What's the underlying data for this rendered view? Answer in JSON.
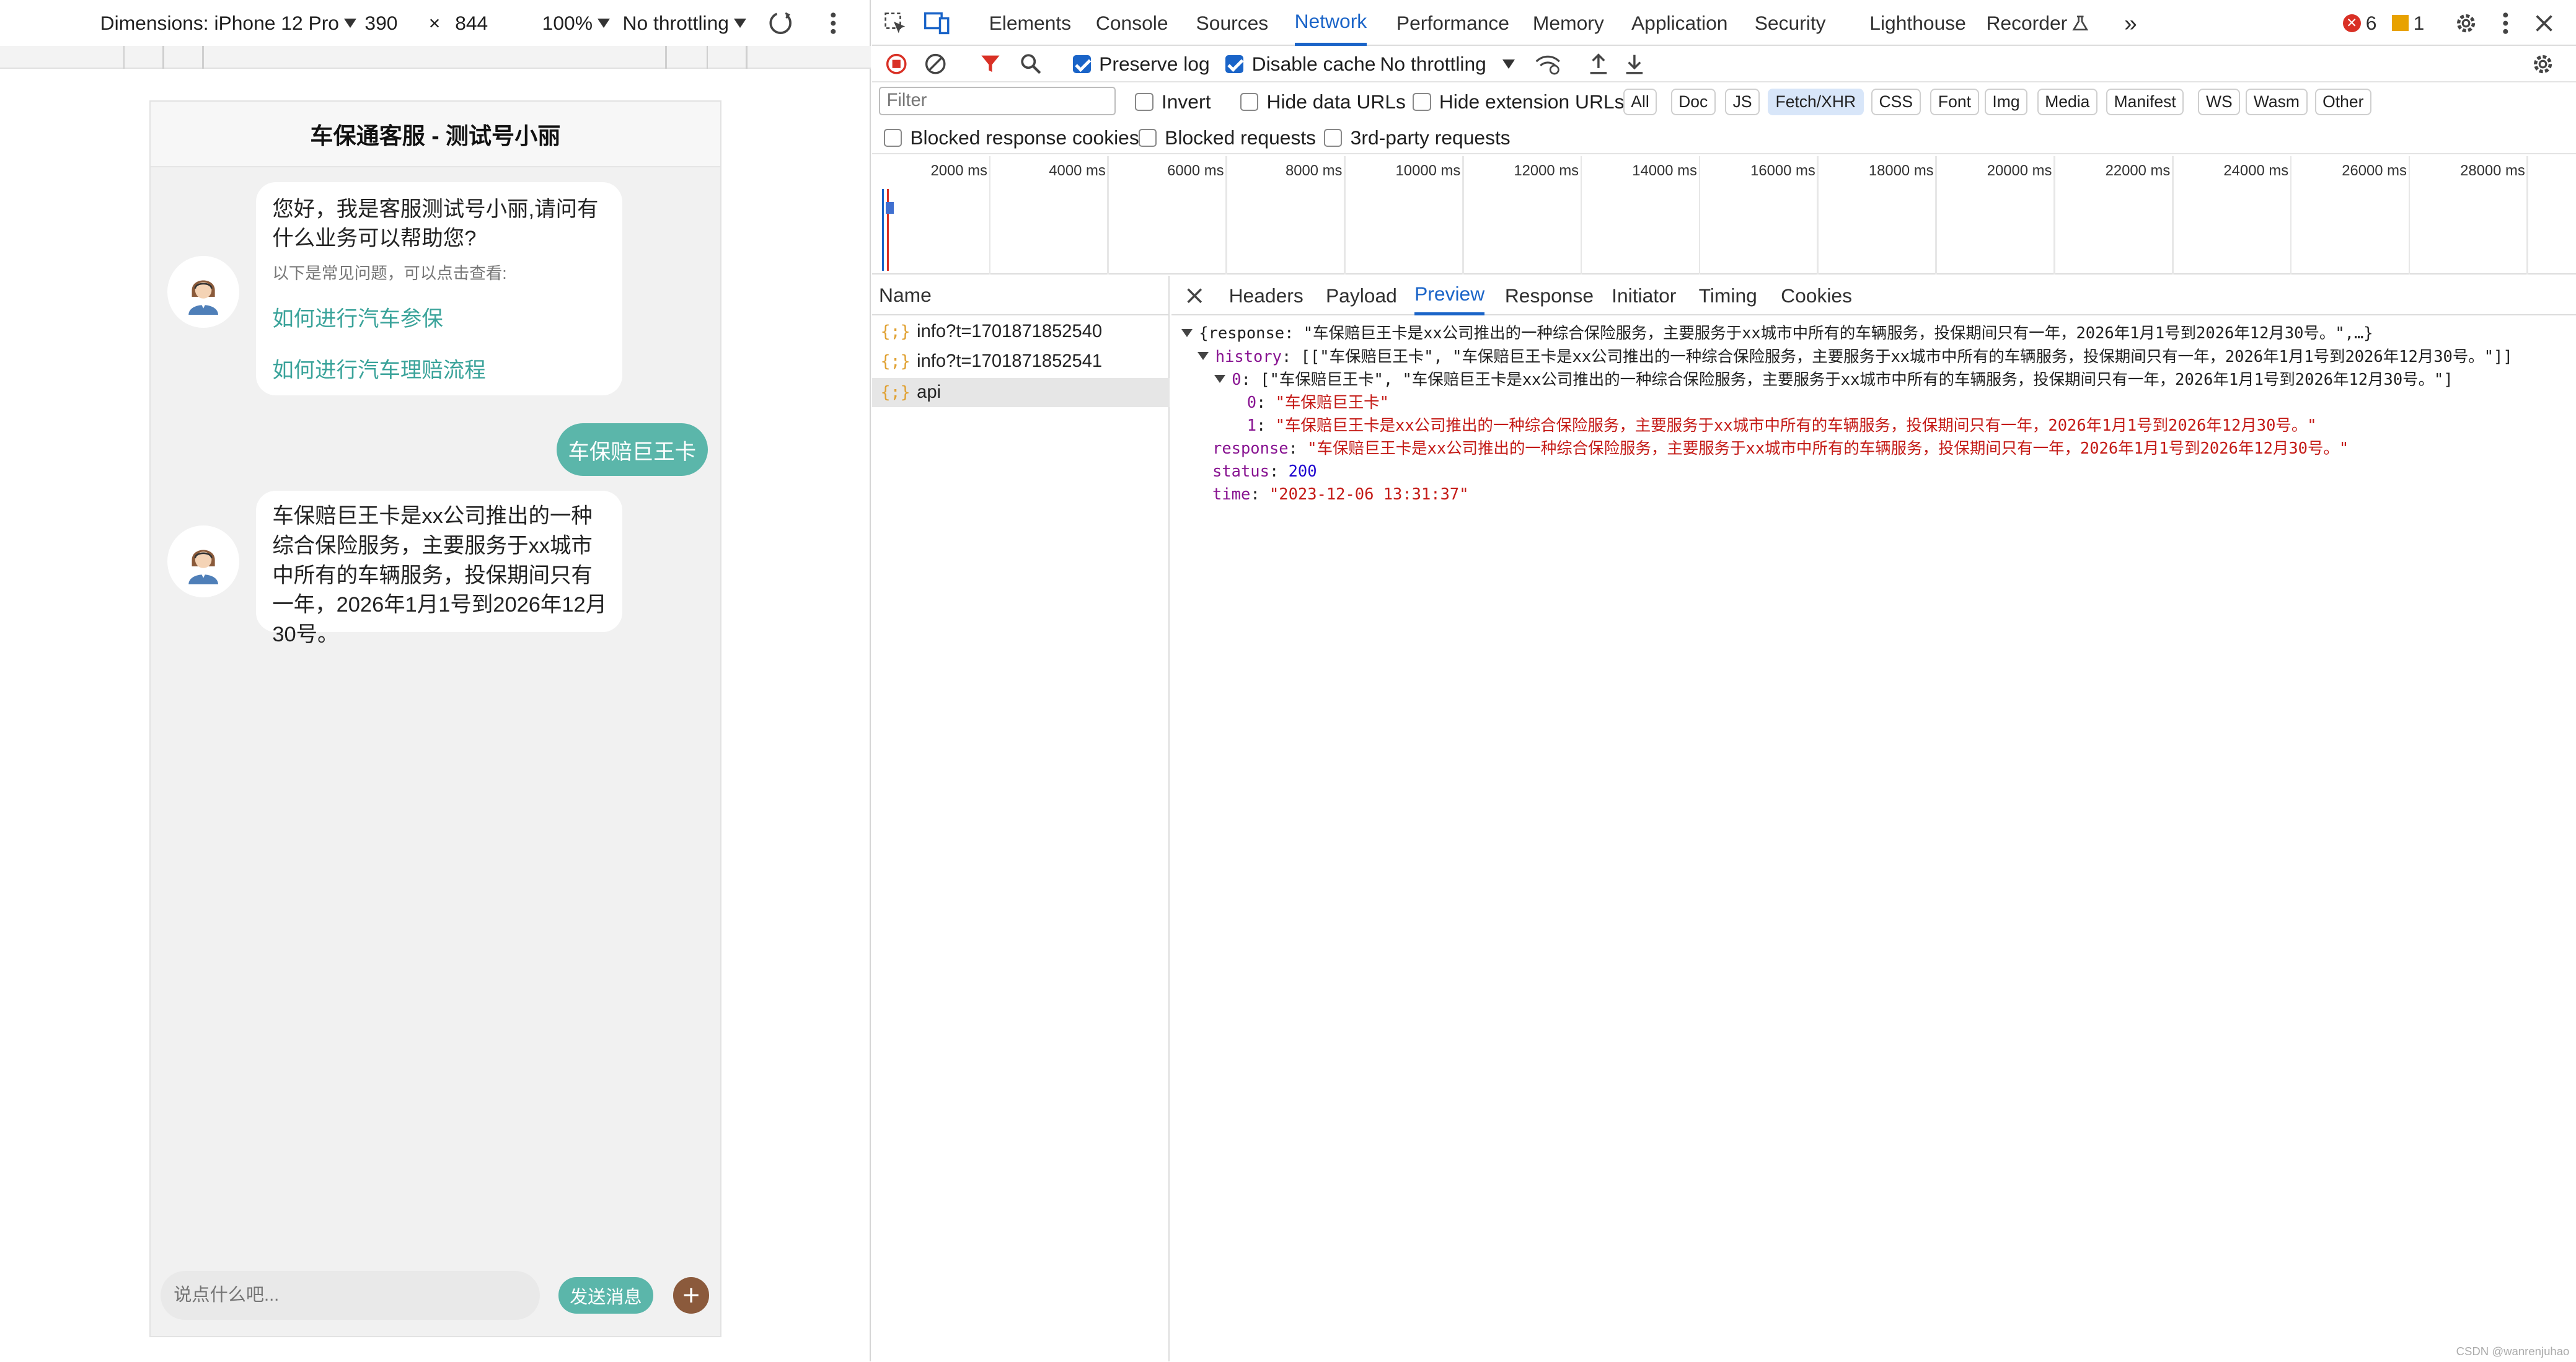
{
  "device_toolbar": {
    "dimensions_label": "Dimensions: iPhone 12 Pro",
    "width": "390",
    "times": "×",
    "height": "844",
    "zoom": "100%",
    "throttling": "No throttling"
  },
  "chat": {
    "title": "车保通客服 - 测试号小丽",
    "greeting": "您好，我是客服测试号小丽,请问有什么业务可以帮助您?",
    "faq_hint": "以下是常见问题，可以点击查看:",
    "faq_links": [
      "如何进行汽车参保",
      "如何进行汽车理赔流程"
    ],
    "user_message": "车保赔巨王卡",
    "reply": "车保赔巨王卡是xx公司推出的一种综合保险服务，主要服务于xx城市中所有的车辆服务，投保期间只有一年，2026年1月1号到2026年12月30号。",
    "input_placeholder": "说点什么吧...",
    "send_label": "发送消息",
    "plus_label": "+"
  },
  "devtools": {
    "tabs": [
      "Elements",
      "Console",
      "Sources",
      "Network",
      "Performance",
      "Memory",
      "Application",
      "Security",
      "Lighthouse",
      "Recorder"
    ],
    "active_tab": "Network",
    "error_count": "6",
    "warning_count": "1",
    "toolbar": {
      "preserve_log": "Preserve log",
      "disable_cache": "Disable cache",
      "throttling": "No throttling"
    },
    "filter_placeholder": "Filter",
    "filter_checks": [
      "Invert",
      "Hide data URLs",
      "Hide extension URLs"
    ],
    "type_chips": [
      "All",
      "Doc",
      "JS",
      "Fetch/XHR",
      "CSS",
      "Font",
      "Img",
      "Media",
      "Manifest",
      "WS",
      "Wasm",
      "Other"
    ],
    "selected_chip": "Fetch/XHR",
    "block_checks": [
      "Blocked response cookies",
      "Blocked requests",
      "3rd-party requests"
    ],
    "timeline_labels": [
      "2000 ms",
      "4000 ms",
      "6000 ms",
      "8000 ms",
      "10000 ms",
      "12000 ms",
      "14000 ms",
      "16000 ms",
      "18000 ms",
      "20000 ms",
      "22000 ms",
      "24000 ms",
      "26000 ms",
      "28000 ms"
    ],
    "name_header": "Name",
    "requests": [
      "info?t=1701871852540",
      "info?t=1701871852541",
      "api"
    ],
    "detail_tabs": [
      "Headers",
      "Payload",
      "Preview",
      "Response",
      "Initiator",
      "Timing",
      "Cookies"
    ],
    "active_detail_tab": "Preview",
    "preview": {
      "line0": "{response: \"车保赔巨王卡是xx公司推出的一种综合保险服务，主要服务于xx城市中所有的车辆服务，投保期间只有一年，2026年1月1号到2026年12月30号。\",…}",
      "history_key": "history",
      "history_val": "[[\"车保赔巨王卡\", \"车保赔巨王卡是xx公司推出的一种综合保险服务，主要服务于xx城市中所有的车辆服务，投保期间只有一年，2026年1月1号到2026年12月30号。\"]]",
      "h0_key": "0",
      "h0_val": "[\"车保赔巨王卡\", \"车保赔巨王卡是xx公司推出的一种综合保险服务，主要服务于xx城市中所有的车辆服务，投保期间只有一年，2026年1月1号到2026年12月30号。\"]",
      "h00_key": "0",
      "h00_val": "\"车保赔巨王卡\"",
      "h01_key": "1",
      "h01_val": "\"车保赔巨王卡是xx公司推出的一种综合保险服务，主要服务于xx城市中所有的车辆服务，投保期间只有一年，2026年1月1号到2026年12月30号。\"",
      "response_key": "response",
      "response_val": "\"车保赔巨王卡是xx公司推出的一种综合保险服务，主要服务于xx城市中所有的车辆服务，投保期间只有一年，2026年1月1号到2026年12月30号。\"",
      "status_key": "status",
      "status_val": "200",
      "time_key": "time",
      "time_val": "\"2023-12-06 13:31:37\""
    },
    "watermark": "CSDN @wanrenjuhao"
  },
  "colors": {
    "accent": "#1a64c8",
    "chat_accent": "#5bb6aa",
    "plus_button": "#8b5a3c"
  }
}
